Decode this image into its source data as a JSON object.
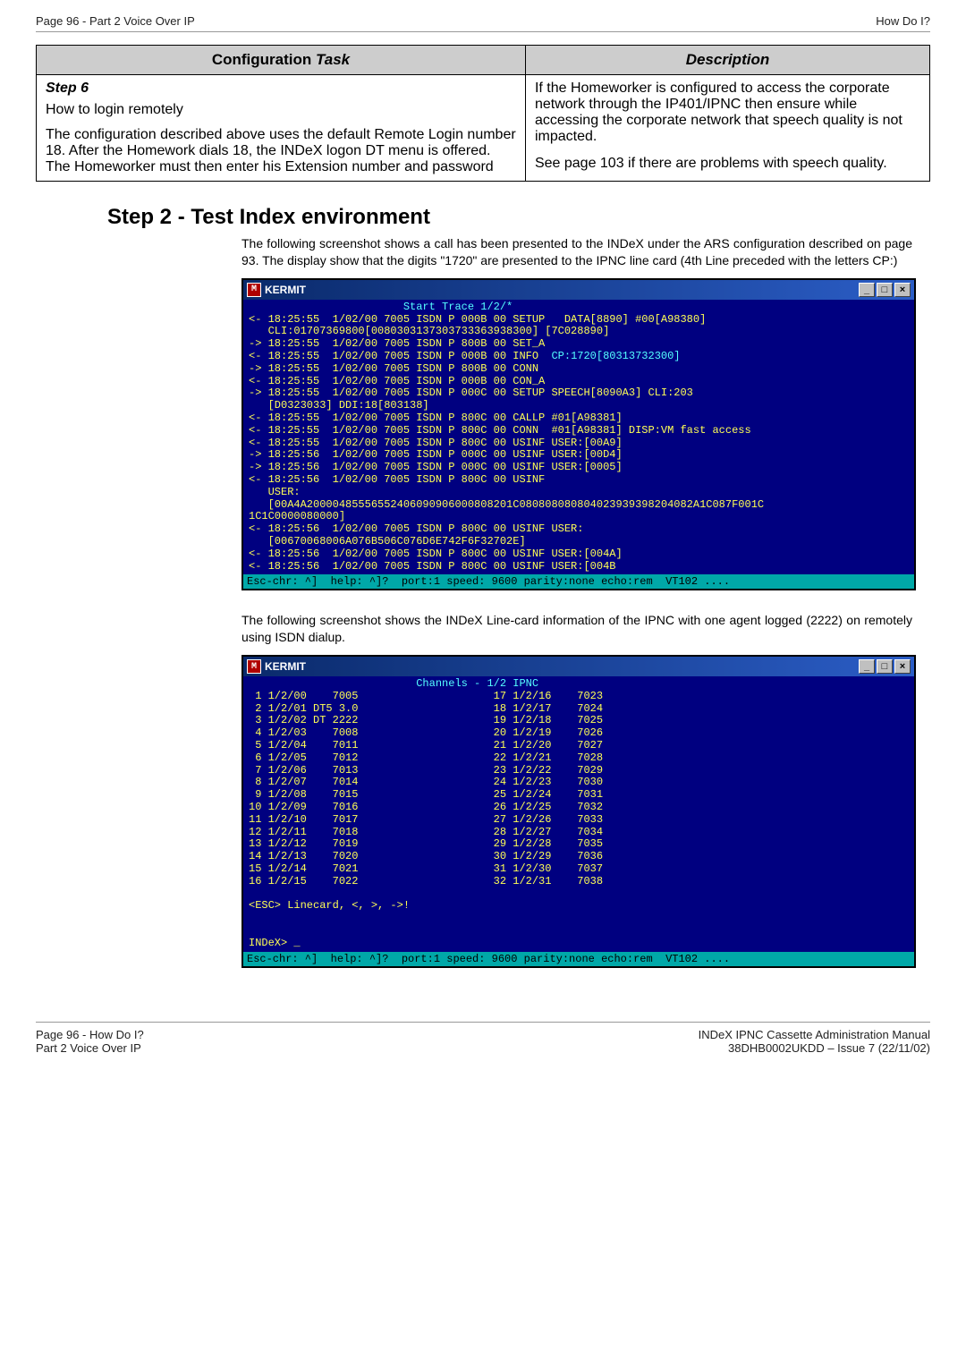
{
  "header": {
    "left": "Page 96 - Part 2 Voice Over IP",
    "right": "How Do I?"
  },
  "table": {
    "col1": "Configuration Task",
    "col2": "Description",
    "step_title": "Step 6",
    "step_sub": "How to login remotely",
    "step_body": "The configuration described above uses the default Remote Login number 18. After the Homework dials 18, the INDeX logon DT menu is offered. The Homeworker must then enter his Extension number and password",
    "desc1": "If the Homeworker is configured to access the corporate network through the IP401/IPNC then ensure while accessing the corporate network that speech quality is not impacted.",
    "desc2": "See page 103 if there are problems with speech quality."
  },
  "section": {
    "title": "Step 2 - Test Index environment",
    "p1": "The following screenshot shows a call has been presented to the INDeX under the ARS configuration described on page 93. The display show that the digits \"1720\" are presented to the IPNC line card (4th Line preceded with the letters CP:)",
    "p2": "The following screenshot shows the INDeX Line-card information of the IPNC with one agent logged (2222) on remotely using ISDN dialup."
  },
  "term1": {
    "title": "KERMIT",
    "minimize": "_",
    "maximize": "□",
    "close": "×",
    "headline": "                        Start Trace 1/2/*",
    "lines": [
      "<- 18:25:55  1/02/00 7005 ISDN P 000B 00 SETUP   DATA[8890] #00[A98380]",
      "   CLI:01707369800[0080303137303733363938300] [7C028890]",
      "-> 18:25:55  1/02/00 7005 ISDN P 800B 00 SET_A",
      "<- 18:25:55  1/02/00 7005 ISDN P 000B 00 INFO  CP:1720[80313732300]",
      "-> 18:25:55  1/02/00 7005 ISDN P 800B 00 CONN",
      "<- 18:25:55  1/02/00 7005 ISDN P 000B 00 CON_A",
      "-> 18:25:55  1/02/00 7005 ISDN P 000C 00 SETUP SPEECH[8090A3] CLI:203",
      "   [D0323033] DDI:18[803138]",
      "<- 18:25:55  1/02/00 7005 ISDN P 800C 00 CALLP #01[A98381]",
      "<- 18:25:55  1/02/00 7005 ISDN P 800C 00 CONN  #01[A98381] DISP:VM fast access",
      "<- 18:25:55  1/02/00 7005 ISDN P 800C 00 USINF USER:[00A9]",
      "-> 18:25:56  1/02/00 7005 ISDN P 000C 00 USINF USER:[00D4]",
      "-> 18:25:56  1/02/00 7005 ISDN P 000C 00 USINF USER:[0005]",
      "<- 18:25:56  1/02/00 7005 ISDN P 800C 00 USINF",
      "   USER:",
      "   [00A4A20000485556552406090906000808201C080808080804023939398204082A1C087F001C",
      "1C1C0000080000]",
      "<- 18:25:56  1/02/00 7005 ISDN P 800C 00 USINF USER:",
      "   [00670068006A076B506C076D6E742F6F32702E]",
      "<- 18:25:56  1/02/00 7005 ISDN P 800C 00 USINF USER:[004A]",
      "<- 18:25:56  1/02/00 7005 ISDN P 800C 00 USINF USER:[004B"
    ],
    "status": "Esc-chr: ^]  help: ^]?  port:1 speed: 9600 parity:none echo:rem  VT102 ...."
  },
  "term2": {
    "title": "KERMIT",
    "headline": "                          Channels - 1/2 IPNC",
    "left_col": [
      " 1 1/2/00    7005",
      " 2 1/2/01 DT5 3.0",
      " 3 1/2/02 DT 2222",
      " 4 1/2/03    7008",
      " 5 1/2/04    7011",
      " 6 1/2/05    7012",
      " 7 1/2/06    7013",
      " 8 1/2/07    7014",
      " 9 1/2/08    7015",
      "10 1/2/09    7016",
      "11 1/2/10    7017",
      "12 1/2/11    7018",
      "13 1/2/12    7019",
      "14 1/2/13    7020",
      "15 1/2/14    7021",
      "16 1/2/15    7022"
    ],
    "right_col": [
      "17 1/2/16    7023",
      "18 1/2/17    7024",
      "19 1/2/18    7025",
      "20 1/2/19    7026",
      "21 1/2/20    7027",
      "22 1/2/21    7028",
      "23 1/2/22    7029",
      "24 1/2/23    7030",
      "25 1/2/24    7031",
      "26 1/2/25    7032",
      "27 1/2/26    7033",
      "28 1/2/27    7034",
      "29 1/2/28    7035",
      "30 1/2/29    7036",
      "31 1/2/30    7037",
      "32 1/2/31    7038"
    ],
    "hint": "<ESC> Linecard, <, >, ->!",
    "prompt": "INDeX> _",
    "status": "Esc-chr: ^]  help: ^]?  port:1 speed: 9600 parity:none echo:rem  VT102 ...."
  },
  "footer": {
    "left1": "Page 96 - How Do I?",
    "left2": "Part 2 Voice Over IP",
    "right1": "INDeX IPNC Cassette Administration Manual",
    "right2": "38DHB0002UKDD – Issue 7 (22/11/02)"
  }
}
